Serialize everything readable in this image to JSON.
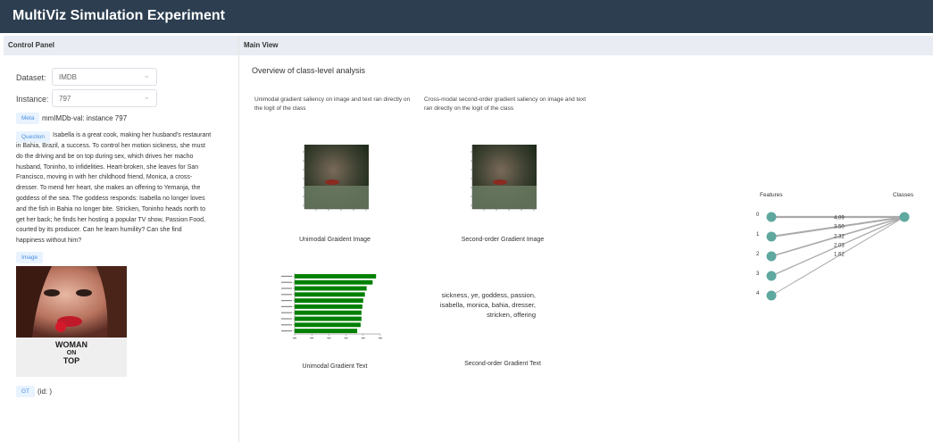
{
  "app": {
    "title": "MultiViz Simulation Experiment"
  },
  "control_panel": {
    "header": "Control Panel",
    "dataset": {
      "label": "Dataset:",
      "value": "IMDB"
    },
    "instance": {
      "label": "Instance:",
      "value": "797"
    },
    "meta": {
      "tag": "Meta",
      "text": "mmIMDb-val: instance 797"
    },
    "question": {
      "tag": "Question",
      "first_line": "Isabella is a great cook, making her husband's restaurant",
      "lines": [
        "in Bahia, Brazil, a success. To control her motion sickness, she must",
        "do the driving and be on top during sex, which drives her macho",
        "husband, Toninho, to infidelities. Heart-broken, she leaves for San",
        "Francisco, moving in with her childhood friend, Monica, a cross-",
        "dresser. To mend her heart, she makes an offering to Yemanja, the",
        "goddess of the sea. The goddess responds: Isabella no longer loves",
        "and the fish in Bahia no longer bite. Stricken, Toninho heads north to",
        "get her back; he finds her hosting a popular TV show, Passion Food,",
        "courted by its producer. Can he learn humility? Can she find",
        "happiness without him?"
      ]
    },
    "image_tag": "Image",
    "poster": {
      "line1": "WOMAN",
      "line2": "ON",
      "line3": "TOP"
    },
    "gt": {
      "tag": "GT",
      "text": "(id: )"
    }
  },
  "main_view": {
    "header": "Main View",
    "title": "Overview of class-level analysis",
    "unimodal_desc": "Unimodal gradient saliency on image and text ran directly on the logit of the class",
    "crossmodal_desc": "Cross-modal second-order gradient saliency on image and text ran directly on the logit of the class",
    "unimodal_image_caption": "Unimodal Graident Image",
    "secondorder_image_caption": "Second-order Gradient Image",
    "unimodal_text_caption": "Unimodal Gradient Text",
    "secondorder_text_caption": "Second-order Gradient Text",
    "secondorder_words": [
      "sickness, ye, goddess, passion,",
      "isabella, monica, bahia, dresser,",
      "stricken, offering"
    ],
    "graph": {
      "features_label": "Features",
      "classes_label": "Classes",
      "features": [
        "0",
        "1",
        "2",
        "3",
        "4"
      ],
      "weights": [
        "4.09",
        "3.50",
        "2.32",
        "2.03",
        "1.62"
      ],
      "node_color": "#5fa8a0",
      "edge_color": "#aaaaaa"
    }
  },
  "chart_data": {
    "type": "bar",
    "orientation": "horizontal",
    "bar_color": "#008000",
    "values": [
      95,
      91,
      84,
      82,
      80,
      79,
      78,
      78,
      77,
      73
    ],
    "xlim": [
      0,
      100
    ]
  }
}
